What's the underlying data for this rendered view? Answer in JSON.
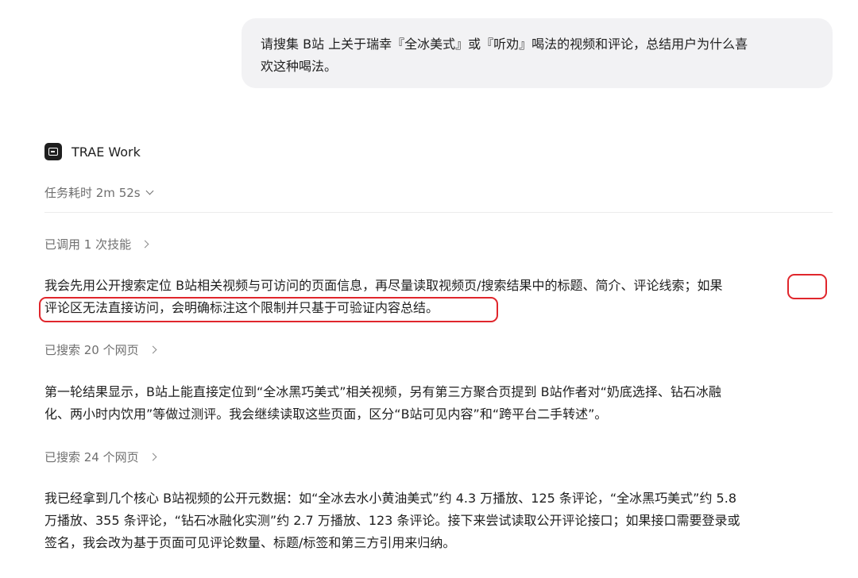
{
  "user_message": {
    "line1": "请搜集 B站 上关于瑞幸『全冰美式』或『听劝』喝法的视频和评论，总结用户为什么喜",
    "line2": "欢这种喝法。"
  },
  "assistant": {
    "name": "TRAE Work",
    "icon": "terminal-icon",
    "duration_label": "任务耗时 2m 52s"
  },
  "steps": {
    "skill_call": "已调用 1 次技能",
    "search_1": "已搜索 20 个网页",
    "search_2": "已搜索 24 个网页"
  },
  "paragraphs": {
    "p1_line1": "我会先用公开搜索定位 B站相关视频与可访问的页面信息，再尽量读取视频页/搜索结果中的标题、简介、评论线索；如果",
    "p1_line2": "评论区无法直接访问，会明确标注这个限制并只基于可验证内容总结。",
    "p2_line1": "第一轮结果显示，B站上能直接定位到“全冰黑巧美式”相关视频，另有第三方聚合页提到 B站作者对“奶底选择、钻石冰融",
    "p2_line2": "化、两小时内饮用”等做过测评。我会继续读取这些页面，区分“B站可见内容”和“跨平台二手转述”。",
    "p3_line1": "我已经拿到几个核心 B站视频的公开元数据：如“全冰去水小黄油美式”约 4.3 万播放、125 条评论，“全冰黑巧美式”约 5.8",
    "p3_line2": "万播放、355 条评论，“钻石冰融化实测”约 2.7 万播放、123 条评论。接下来尝试读取公开评论接口；如果接口需要登录或",
    "p3_line3": "签名，我会改为基于页面可见评论数量、标题/标签和第三方引用来归纳。"
  },
  "colors": {
    "highlight": "#e0262c",
    "bubble": "#f2f2f4",
    "muted_text": "#6f6f6f"
  }
}
